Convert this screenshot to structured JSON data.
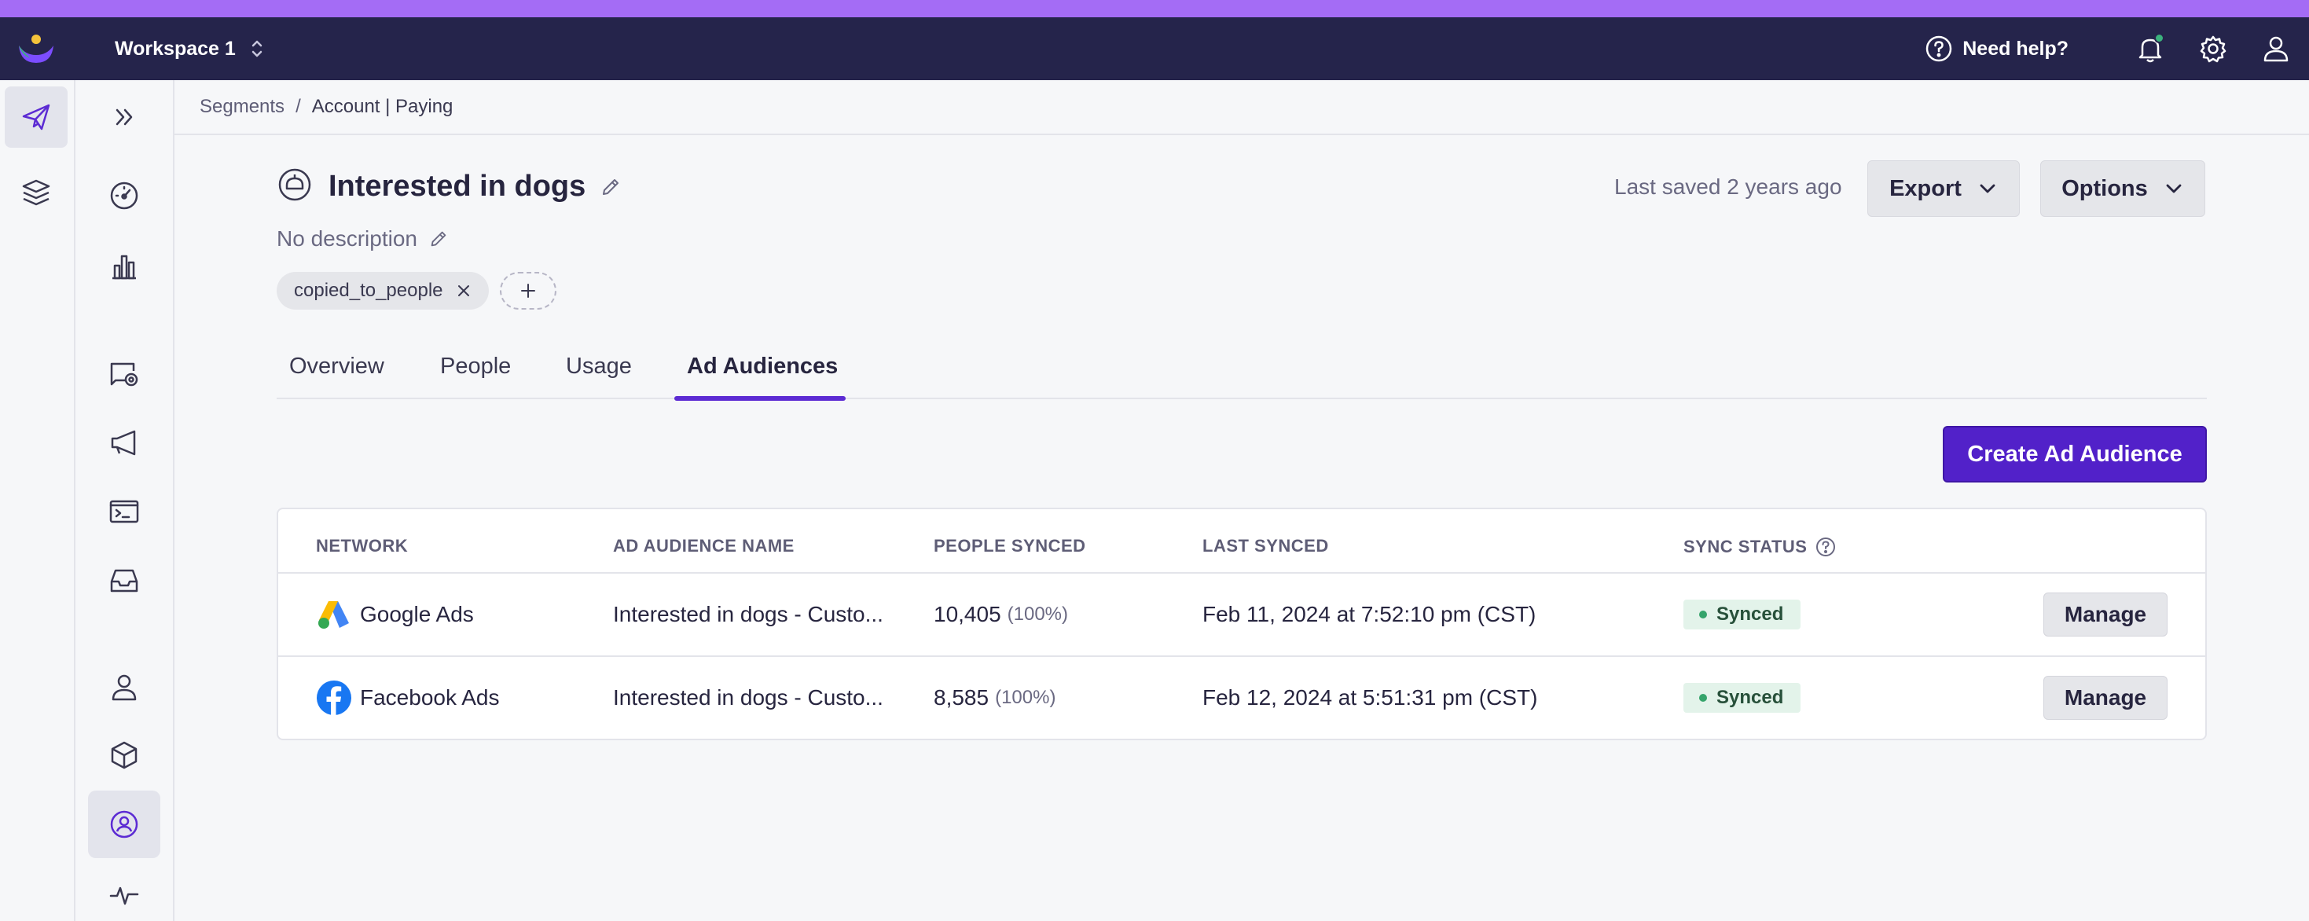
{
  "colors": {
    "accent_strip": "#a46cf5",
    "topbar": "#25244b",
    "primary": "#5221c9",
    "tab_active": "#5c2bd3",
    "synced_bg": "#e3f3ea",
    "synced_dot": "#35a46b"
  },
  "topbar": {
    "workspace": "Workspace 1",
    "help_label": "Need help?",
    "icons": [
      "logo-icon",
      "chevron-updown-icon",
      "help-circle-icon",
      "bell-icon",
      "gear-icon",
      "user-icon"
    ]
  },
  "rail": {
    "items": [
      {
        "name": "paper-plane-icon",
        "active": true
      },
      {
        "name": "layers-icon",
        "active": false
      }
    ]
  },
  "nav": {
    "items": [
      {
        "name": "expand-chevrons-icon",
        "active": false
      },
      {
        "name": "gauge-icon",
        "active": false
      },
      {
        "name": "bar-chart-icon",
        "active": false
      },
      {
        "name": "message-settings-icon",
        "active": false
      },
      {
        "name": "megaphone-icon",
        "active": false
      },
      {
        "name": "terminal-icon",
        "active": false
      },
      {
        "name": "inbox-icon",
        "active": false
      },
      {
        "name": "person-icon",
        "active": false
      },
      {
        "name": "cube-icon",
        "active": false
      },
      {
        "name": "person-circle-icon",
        "active": true
      },
      {
        "name": "activity-icon",
        "active": false
      }
    ]
  },
  "breadcrumb": {
    "parent": "Segments",
    "separator": "/",
    "current": "Account | Paying"
  },
  "header": {
    "title": "Interested in dogs",
    "description": "No description",
    "tags": [
      "copied_to_people"
    ],
    "last_saved": "Last saved 2 years ago",
    "export_label": "Export",
    "options_label": "Options"
  },
  "tabs": [
    {
      "label": "Overview",
      "active": false
    },
    {
      "label": "People",
      "active": false
    },
    {
      "label": "Usage",
      "active": false
    },
    {
      "label": "Ad Audiences",
      "active": true
    }
  ],
  "create_button": "Create Ad Audience",
  "table": {
    "columns": [
      "NETWORK",
      "AD AUDIENCE NAME",
      "PEOPLE SYNCED",
      "LAST SYNCED",
      "SYNC STATUS"
    ],
    "rows": [
      {
        "network": "Google Ads",
        "network_icon": "google-ads-icon",
        "audience_name": "Interested in dogs - Custo...",
        "people_synced": "10,405",
        "people_pct": "(100%)",
        "last_synced": "Feb 11, 2024 at 7:52:10 pm (CST)",
        "status": "Synced",
        "action": "Manage"
      },
      {
        "network": "Facebook Ads",
        "network_icon": "facebook-icon",
        "audience_name": "Interested in dogs - Custo...",
        "people_synced": "8,585",
        "people_pct": "(100%)",
        "last_synced": "Feb 12, 2024 at 5:51:31 pm (CST)",
        "status": "Synced",
        "action": "Manage"
      }
    ]
  }
}
